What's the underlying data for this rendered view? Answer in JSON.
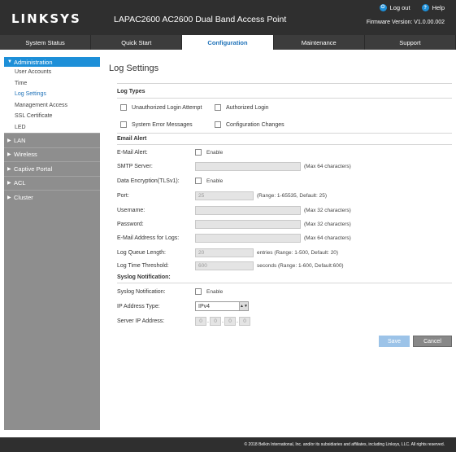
{
  "header": {
    "logo": "LINKSYS",
    "product_title": "LAPAC2600 AC2600 Dual Band Access Point",
    "logout_label": "Log out",
    "help_label": "Help",
    "firmware": "Firmware Version: V1.0.00.002"
  },
  "topnav": {
    "tabs": [
      {
        "label": "System Status"
      },
      {
        "label": "Quick Start"
      },
      {
        "label": "Configuration"
      },
      {
        "label": "Maintenance"
      },
      {
        "label": "Support"
      }
    ]
  },
  "sidebar": {
    "admin_label": "Administration",
    "admin_items": [
      {
        "label": "User Accounts"
      },
      {
        "label": "Time"
      },
      {
        "label": "Log Settings"
      },
      {
        "label": "Management Access"
      },
      {
        "label": "SSL Certificate"
      },
      {
        "label": "LED"
      }
    ],
    "sections": [
      {
        "label": "LAN"
      },
      {
        "label": "Wireless"
      },
      {
        "label": "Captive Portal"
      },
      {
        "label": "ACL"
      },
      {
        "label": "Cluster"
      }
    ]
  },
  "main": {
    "title": "Log Settings",
    "log_types": {
      "heading": "Log Types",
      "unauthorized_login": "Unauthorized Login Attempt",
      "authorized_login": "Authorized Login",
      "system_error": "System Error Messages",
      "config_changes": "Configuration Changes"
    },
    "email": {
      "heading": "Email Alert",
      "email_alert_label": "E-Mail Alert:",
      "enable": "Enable",
      "smtp_label": "SMTP Server:",
      "smtp_hint": "(Max 64 characters)",
      "encryption_label": "Data Encryption(TLSv1):",
      "port_label": "Port:",
      "port_value": "25",
      "port_hint": "(Range: 1-65535, Default: 25)",
      "username_label": "Username:",
      "username_hint": "(Max 32 characters)",
      "password_label": "Password:",
      "password_hint": "(Max 32 characters)",
      "email_for_logs_label": "E-Mail Address for Logs:",
      "email_for_logs_hint": "(Max 64 characters)",
      "queue_label": "Log Queue Length:",
      "queue_value": "20",
      "queue_hint": "entries (Range: 1-500, Default: 20)",
      "threshold_label": "Log Time Threshold:",
      "threshold_value": "600",
      "threshold_hint": "seconds (Range: 1-600, Default:600)"
    },
    "syslog": {
      "heading": "Syslog Notification:",
      "notification_label": "Syslog Notification:",
      "enable": "Enable",
      "ip_type_label": "IP Address Type:",
      "ip_type_value": "IPv4",
      "server_ip_label": "Server IP Address:",
      "ip_octets": [
        "0",
        "0",
        "0",
        "0"
      ]
    },
    "save_label": "Save",
    "cancel_label": "Cancel"
  },
  "footer": {
    "copyright": "© 2018 Belkin International, Inc. and/or its subsidiaries and affiliates, including Linksys, LLC. All rights reserved."
  }
}
